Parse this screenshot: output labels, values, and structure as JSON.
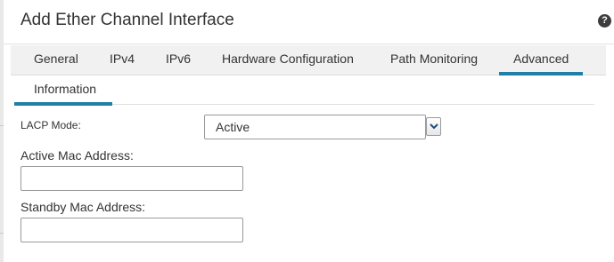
{
  "dialog": {
    "title": "Add Ether Channel Interface",
    "help_icon": "help-icon",
    "help_glyph": "?"
  },
  "tabs": [
    {
      "label": "General",
      "active": false
    },
    {
      "label": "IPv4",
      "active": false
    },
    {
      "label": "IPv6",
      "active": false
    },
    {
      "label": "Hardware Configuration",
      "active": false
    },
    {
      "label": "Path Monitoring",
      "active": false
    },
    {
      "label": "Advanced",
      "active": true
    }
  ],
  "subtabs": [
    {
      "label": "Information",
      "active": true
    }
  ],
  "form": {
    "lacp_mode": {
      "label": "LACP Mode:",
      "value": "Active",
      "icon": "chevron-down-icon"
    },
    "active_mac": {
      "label": "Active Mac Address:",
      "value": ""
    },
    "standby_mac": {
      "label": "Standby Mac Address:",
      "value": ""
    }
  },
  "colors": {
    "accent": "#1f7fa5",
    "tab_bar_bg": "#f1f1f1",
    "text": "#333333",
    "dropdown_arrow": "#1f4e79"
  }
}
